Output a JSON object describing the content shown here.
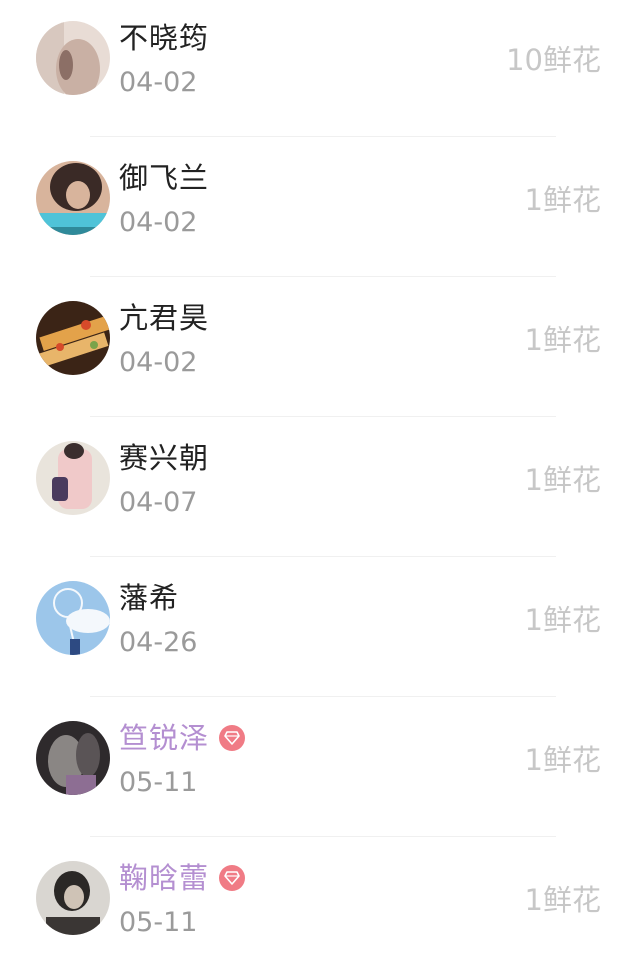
{
  "records": [
    {
      "name": "不晓筠",
      "date": "04-02",
      "gift": "10鲜花",
      "vip": false,
      "avatar_colors": [
        "#e8dcd5",
        "#c9b0a4",
        "#8c6f66"
      ]
    },
    {
      "name": "御飞兰",
      "date": "04-02",
      "gift": "1鲜花",
      "vip": false,
      "avatar_colors": [
        "#3a2a26",
        "#d8b49c",
        "#4fc3d8"
      ]
    },
    {
      "name": "亢君昊",
      "date": "04-02",
      "gift": "1鲜花",
      "vip": false,
      "avatar_colors": [
        "#3b2416",
        "#e3a24a",
        "#d64a2a"
      ]
    },
    {
      "name": "赛兴朝",
      "date": "04-07",
      "gift": "1鲜花",
      "vip": false,
      "avatar_colors": [
        "#e9e4dc",
        "#f0c9c9",
        "#4a3b5e"
      ]
    },
    {
      "name": "藩希",
      "date": "04-26",
      "gift": "1鲜花",
      "vip": false,
      "avatar_colors": [
        "#9cc6ea",
        "#f4f8fc",
        "#2d4a82"
      ]
    },
    {
      "name": "笪锐泽",
      "date": "05-11",
      "gift": "1鲜花",
      "vip": true,
      "avatar_colors": [
        "#2e2a2c",
        "#8a8684",
        "#5a5456"
      ]
    },
    {
      "name": "鞠晗蕾",
      "date": "05-11",
      "gift": "1鲜花",
      "vip": true,
      "avatar_colors": [
        "#d9d6d1",
        "#2b2826",
        "#cfc3b6"
      ]
    }
  ],
  "colors": {
    "name": "#222222",
    "vip_name": "#b48fd1",
    "date": "#9a9a9a",
    "gift": "#c7c7c7",
    "vip_badge": "#f07b85",
    "divider": "#f0f0f0"
  },
  "icons": {
    "vip_badge": "diamond-icon"
  }
}
